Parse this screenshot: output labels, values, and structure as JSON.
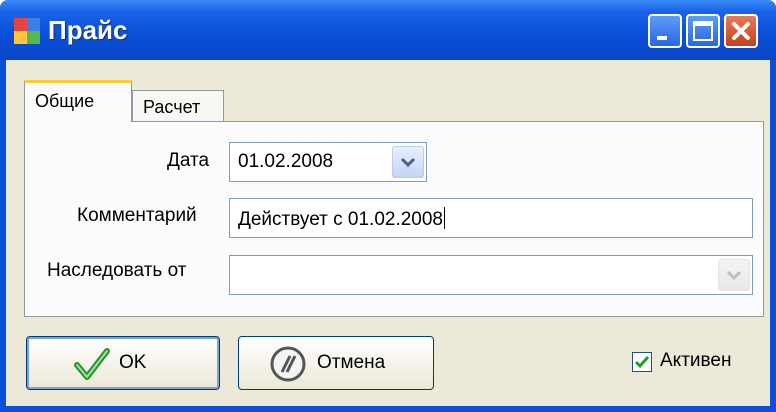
{
  "window": {
    "title": "Прайс"
  },
  "tabs": [
    {
      "label": "Общие",
      "active": true
    },
    {
      "label": "Расчет",
      "active": false
    }
  ],
  "form": {
    "date_label": "Дата",
    "date_value": "01.02.2008",
    "comment_label": "Комментарий",
    "comment_value": "Действует с 01.02.2008",
    "inherit_label": "Наследовать от",
    "inherit_value": ""
  },
  "buttons": {
    "ok": "OK",
    "cancel": "Отмена"
  },
  "active_checkbox": {
    "label": "Активен",
    "checked": true
  },
  "colors": {
    "titlebar": "#0a50d9",
    "client": "#ece9d8",
    "accent_tab": "#ffc83c"
  },
  "icons": [
    "app-icon",
    "minimize-icon",
    "maximize-icon",
    "close-icon",
    "chevron-down-icon",
    "checkmark-icon",
    "cancel-icon",
    "checkbox-check-icon"
  ]
}
